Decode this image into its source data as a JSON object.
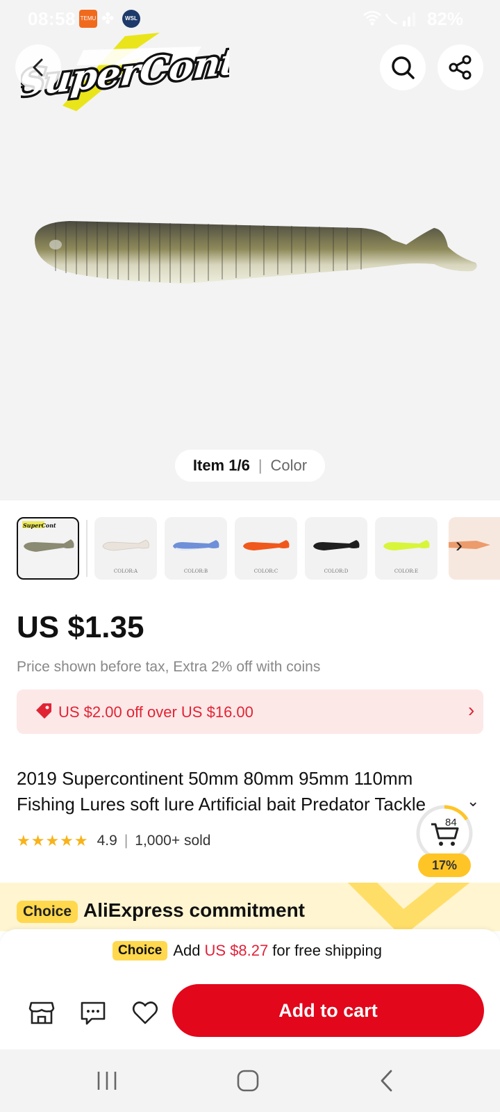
{
  "status_bar": {
    "time": "08:58",
    "temu_label": "TEMU",
    "wsl_label": "WSL",
    "battery": "82%"
  },
  "hero": {
    "brand_logo_text": "SuperContinent",
    "item_counter": "Item 1/6",
    "item_label": "Color"
  },
  "thumbnails": [
    {
      "caption": "",
      "color": "#8b8a72"
    },
    {
      "caption": "COLOR:A",
      "color": "#e9e3db"
    },
    {
      "caption": "COLOR:B",
      "color": "#6f8fd8"
    },
    {
      "caption": "COLOR:C",
      "color": "#f0581c"
    },
    {
      "caption": "COLOR:D",
      "color": "#1f1f1f"
    },
    {
      "caption": "COLOR:E",
      "color": "#d9f53a"
    }
  ],
  "product": {
    "price": "US $1.35",
    "price_note": "Price shown before tax, Extra 2% off with coins",
    "coupon_text": "US $2.00 off over US $16.00",
    "title": "2019 Supercontinent 50mm 80mm 95mm 110mm Fishing Lures soft lure Artificial bait Predator Tackle",
    "rating": "4.9",
    "sold": "1,000+ sold"
  },
  "cart_float": {
    "count": "84",
    "percent": "17%"
  },
  "choice_banner": {
    "tag": "Choice",
    "text": "AliExpress commitment"
  },
  "shipping_bar": {
    "tag": "Choice",
    "prefix": "Add",
    "amount": "US $8.27",
    "suffix": "for free shipping"
  },
  "action_bar": {
    "add_to_cart": "Add to cart"
  },
  "colors": {
    "accent": "#e2071b",
    "choice_yellow": "#ffd84d",
    "star": "#f8b31b"
  }
}
